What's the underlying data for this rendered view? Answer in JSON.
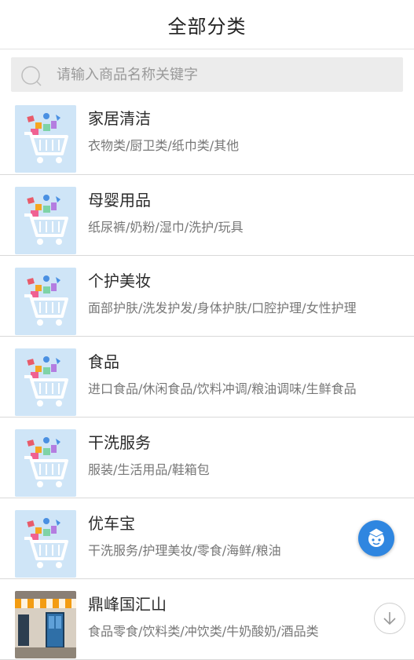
{
  "header": {
    "title": "全部分类"
  },
  "search": {
    "placeholder": "请输入商品名称关键字"
  },
  "categories": [
    {
      "name": "家居清洁",
      "sub": "衣物类/厨卫类/纸巾类/其他",
      "icon": "shopping-cart-icon"
    },
    {
      "name": "母婴用品",
      "sub": "纸尿裤/奶粉/湿巾/洗护/玩具",
      "icon": "shopping-cart-icon"
    },
    {
      "name": "个护美妆",
      "sub": "面部护肤/洗发护发/身体护肤/口腔护理/女性护理",
      "icon": "shopping-cart-icon"
    },
    {
      "name": "食品",
      "sub": "进口食品/休闲食品/饮料冲调/粮油调味/生鲜食品",
      "icon": "shopping-cart-icon"
    },
    {
      "name": "干洗服务",
      "sub": "服装/生活用品/鞋箱包",
      "icon": "shopping-cart-icon"
    },
    {
      "name": "优车宝",
      "sub": "干洗服务/护理美妆/零食/海鲜/粮油",
      "icon": "shopping-cart-icon"
    },
    {
      "name": "鼎峰国汇山",
      "sub": "食品零食/饮料类/冲饮类/牛奶酸奶/酒品类",
      "icon": "store-front-icon"
    }
  ],
  "colors": {
    "accent": "#2f86e0",
    "thumb_bg": "#cfe5f7"
  }
}
